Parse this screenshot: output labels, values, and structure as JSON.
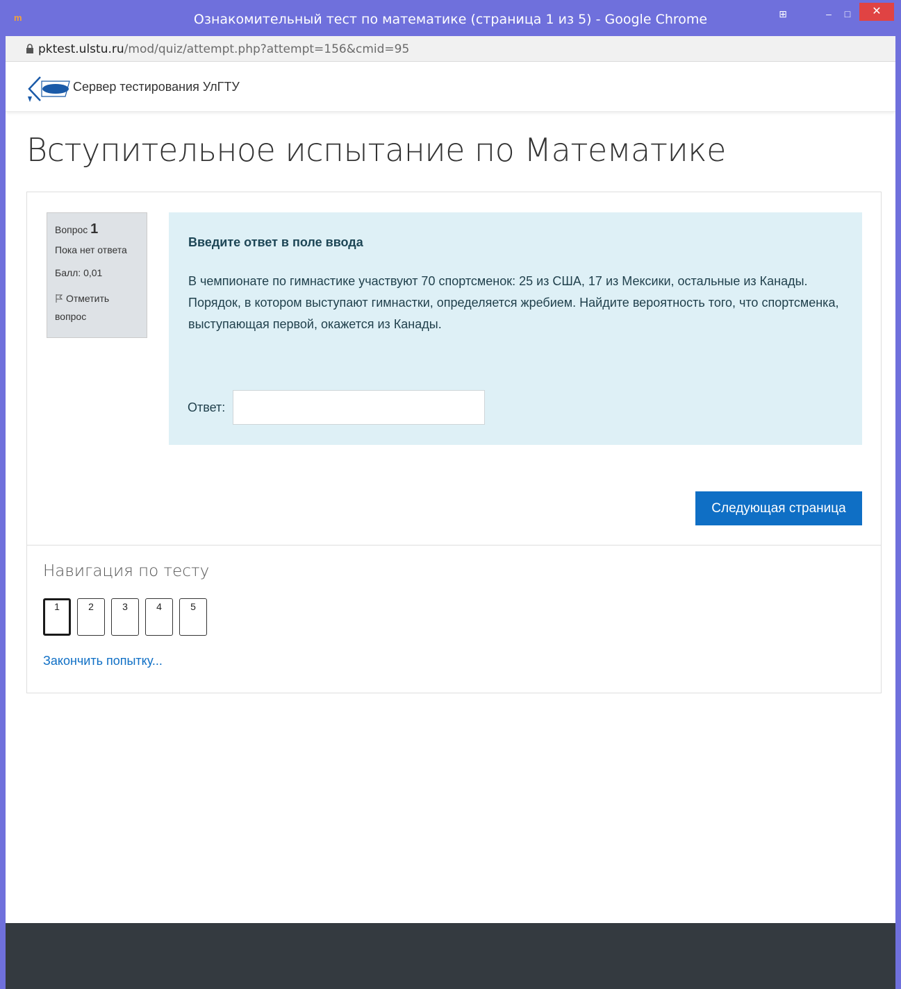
{
  "window": {
    "title": "Ознакомительный тест по математике (страница 1 из 5) - Google Chrome",
    "url_domain": "pktest.ulstu.ru",
    "url_path": "/mod/quiz/attempt.php?attempt=156&cmid=95"
  },
  "site": {
    "name": "Сервер тестирования УлГТУ",
    "logo_text": "УлГТУ"
  },
  "page": {
    "title": "Вступительное испытание по Математике"
  },
  "question": {
    "label": "Вопрос",
    "number": "1",
    "status": "Пока нет ответа",
    "score": "Балл: 0,01",
    "flag_label": "Отметить вопрос",
    "prompt": "Введите ответ в поле ввода",
    "text": "В чемпионате по гимнастике участвуют 70 спортсменок: 25 из США, 17 из Мексики, остальные из Канады. Порядок, в котором выступают гимнастки, определяется жребием. Найдите вероятность того, что спортсменка, выступающая первой, окажется из Канады.",
    "answer_label": "Ответ:",
    "answer_value": ""
  },
  "actions": {
    "next_label": "Следующая страница",
    "finish_label": "Закончить попытку..."
  },
  "navigation": {
    "title": "Навигация по тесту",
    "pages": [
      "1",
      "2",
      "3",
      "4",
      "5"
    ],
    "current": "1"
  },
  "colors": {
    "accent": "#0f6fc5",
    "question_bg": "#def0f6",
    "footer": "#343a40",
    "window_frame": "#6f70dc"
  }
}
